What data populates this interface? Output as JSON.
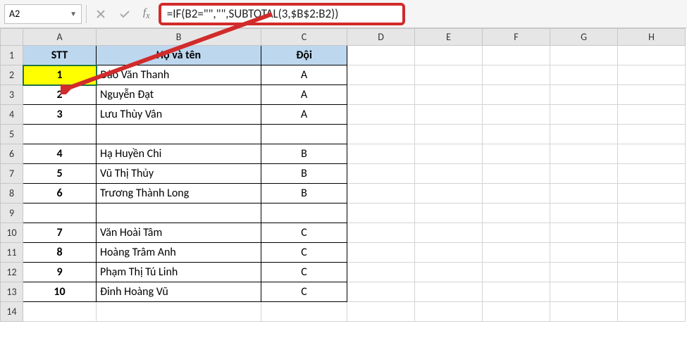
{
  "nameBox": {
    "value": "A2"
  },
  "formulaBar": {
    "formula": "=IF(B2=\"\",\"\",SUBTOTAL(3,$B$2:B2))"
  },
  "columns": [
    "A",
    "B",
    "C",
    "D",
    "E",
    "F",
    "G",
    "H"
  ],
  "rowNumbers": [
    1,
    2,
    3,
    4,
    5,
    6,
    7,
    8,
    9,
    10,
    11,
    12,
    13,
    14
  ],
  "headers": {
    "A": "STT",
    "B": "Họ và tên",
    "C": "Đội"
  },
  "rows": [
    {
      "stt": "1",
      "name": "Đào Văn Thanh",
      "team": "A",
      "selected": true
    },
    {
      "stt": "2",
      "name": "Nguyễn Đạt",
      "team": "A"
    },
    {
      "stt": "3",
      "name": "Lưu Thùy Vân",
      "team": "A"
    },
    {
      "stt": "",
      "name": "",
      "team": ""
    },
    {
      "stt": "4",
      "name": "Hạ Huyền Chi",
      "team": "B"
    },
    {
      "stt": "5",
      "name": "Vũ Thị Thủy",
      "team": "B"
    },
    {
      "stt": "6",
      "name": "Trương Thành Long",
      "team": "B"
    },
    {
      "stt": "",
      "name": "",
      "team": ""
    },
    {
      "stt": "7",
      "name": "Văn Hoài Tâm",
      "team": "C"
    },
    {
      "stt": "8",
      "name": "Hoàng Trâm Anh",
      "team": "C"
    },
    {
      "stt": "9",
      "name": "Phạm Thị Tú Linh",
      "team": "C"
    },
    {
      "stt": "10",
      "name": "Đinh Hoàng Vũ",
      "team": "C"
    }
  ],
  "chart_data": null
}
